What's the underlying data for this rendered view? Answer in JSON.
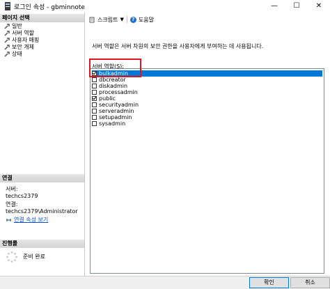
{
  "window": {
    "title": "로그인 속성 - gbminnote"
  },
  "left_panel": {
    "page_select_header": "페이지 선택",
    "nav_items": [
      {
        "label": "일반"
      },
      {
        "label": "서버 역할"
      },
      {
        "label": "사용자 매핑"
      },
      {
        "label": "보안 개체"
      },
      {
        "label": "상태"
      }
    ],
    "connection_header": "연결",
    "server_label": "서버:",
    "server_value": "techcs2379",
    "connection_label": "연결:",
    "connection_value": "techcs2379\\Administrator",
    "view_connection_link": "연결 속성 보기",
    "progress_header": "진행률",
    "status_text": "준비 완료"
  },
  "toolbar": {
    "script_label": "스크립트",
    "help_label": "도움말"
  },
  "main": {
    "description": "서버 역할은 서버 차원의 보안 권한을 사용자에게 부여하는 데 사용됩니다.",
    "roles_label": "서버 역할(S):",
    "roles": [
      {
        "name": "bulkadmin",
        "checked": true,
        "selected": true
      },
      {
        "name": "dbcreator",
        "checked": false,
        "selected": false
      },
      {
        "name": "diskadmin",
        "checked": false,
        "selected": false
      },
      {
        "name": "processadmin",
        "checked": false,
        "selected": false
      },
      {
        "name": "public",
        "checked": true,
        "selected": false
      },
      {
        "name": "securityadmin",
        "checked": false,
        "selected": false
      },
      {
        "name": "serveradmin",
        "checked": false,
        "selected": false
      },
      {
        "name": "setupadmin",
        "checked": false,
        "selected": false
      },
      {
        "name": "sysadmin",
        "checked": false,
        "selected": false
      }
    ]
  },
  "buttons": {
    "ok": "확인",
    "cancel": "취소"
  },
  "colors": {
    "selection": "#0078d7",
    "highlight_box": "#e0141e",
    "link": "#0b4ec9"
  }
}
